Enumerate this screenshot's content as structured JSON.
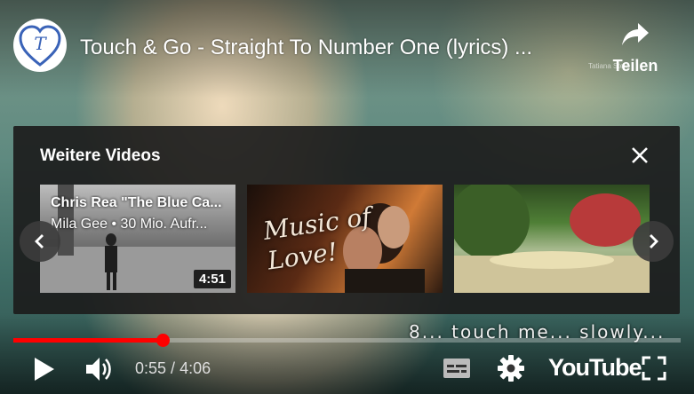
{
  "video": {
    "title": "Touch & Go - Straight To Number One (lyrics) ...",
    "share_label": "Teilen",
    "watermark": "Tatiana Stela"
  },
  "more_videos": {
    "heading": "Weitere Videos",
    "items": [
      {
        "title": "Chris Rea \"The Blue Ca...",
        "meta": "Mila Gee • 30 Mio. Aufr...",
        "duration": "4:51"
      },
      {
        "overlay_text": "Music of Love!"
      },
      {}
    ]
  },
  "lyrics": "8... touch me... slowly...",
  "controls": {
    "time_current": "0:55",
    "time_separator": " / ",
    "time_total": "4:06",
    "progress_fraction": 0.2235,
    "youtube_label": "YouTube"
  },
  "colors": {
    "accent": "#ff0000",
    "panel": "#1c1c1c"
  },
  "icons": [
    "channel-logo-heart-t",
    "share-arrow-icon",
    "close-icon",
    "chevron-left-icon",
    "chevron-right-icon",
    "play-icon",
    "volume-icon",
    "subtitles-icon",
    "settings-gear-icon",
    "fullscreen-icon"
  ]
}
